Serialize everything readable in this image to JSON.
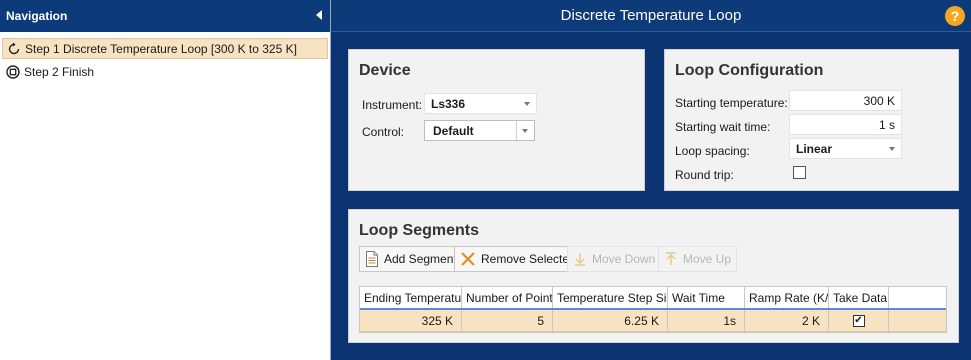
{
  "navigation": {
    "title": "Navigation",
    "items": [
      {
        "label": "Step 1 Discrete Temperature Loop [300 K to 325 K]",
        "icon": "loop-icon",
        "selected": true
      },
      {
        "label": "Step 2 Finish",
        "icon": "finish-icon",
        "selected": false
      }
    ]
  },
  "main": {
    "title": "Discrete Temperature Loop",
    "help_label": "?"
  },
  "device": {
    "title": "Device",
    "instrument_label": "Instrument:",
    "instrument_value": "Ls336",
    "control_label": "Control:",
    "control_value": "Default"
  },
  "loop_config": {
    "title": "Loop Configuration",
    "start_temp_label": "Starting temperature:",
    "start_temp_value": "300 K",
    "start_wait_label": "Starting wait time:",
    "start_wait_value": "1 s",
    "spacing_label": "Loop spacing:",
    "spacing_value": "Linear",
    "round_trip_label": "Round trip:",
    "round_trip_checked": false
  },
  "segments": {
    "title": "Loop Segments",
    "toolbar": {
      "add_label": "Add Segment",
      "remove_label": "Remove Selected",
      "move_down_label": "Move Down",
      "move_up_label": "Move Up"
    },
    "columns": [
      "Ending Temperature",
      "Number of Points",
      "Temperature Step Size",
      "Wait Time",
      "Ramp Rate (K/s)",
      "Take Data"
    ],
    "rows": [
      {
        "ending_temperature": "325 K",
        "number_of_points": "5",
        "step_size": "6.25 K",
        "wait_time": "1s",
        "ramp_rate": "2 K",
        "take_data": true
      }
    ]
  },
  "colors": {
    "header_bg": "#0d3b7a",
    "main_bg": "#0c3473",
    "selection": "#f7e2c2",
    "help_accent": "#f5a623"
  }
}
